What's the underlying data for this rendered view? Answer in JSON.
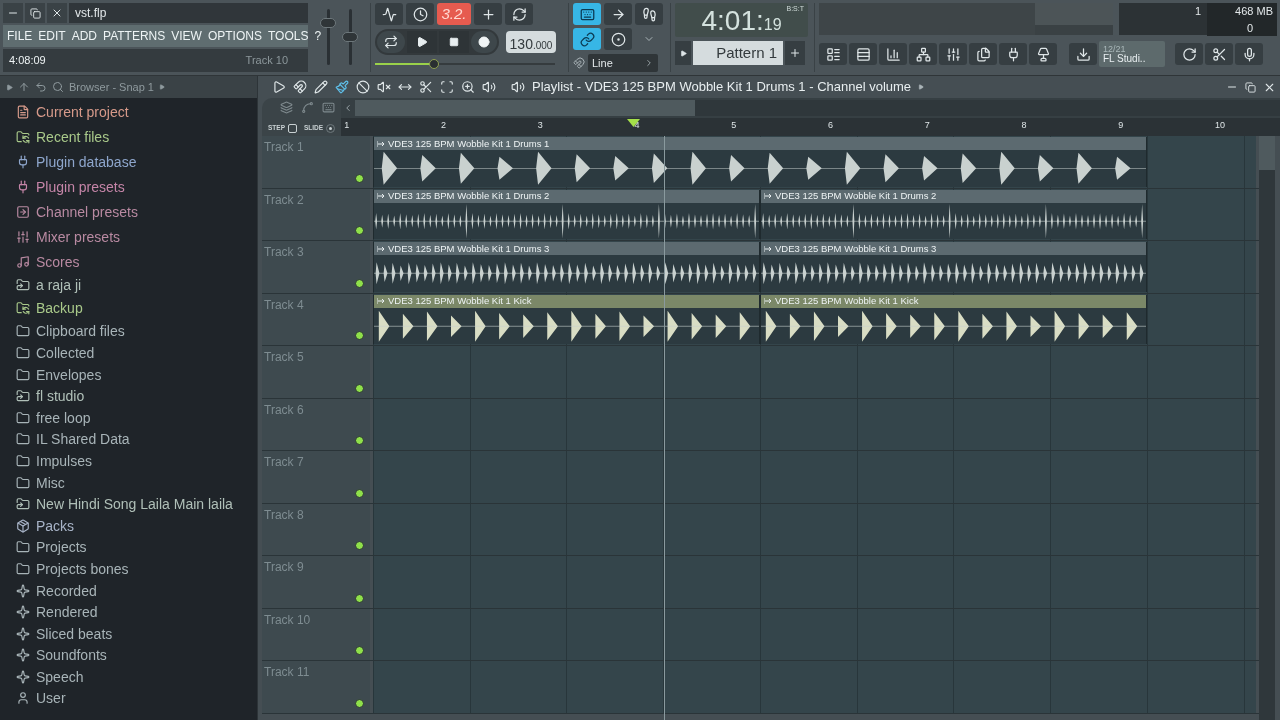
{
  "window": {
    "title": "vst.flp"
  },
  "menu": [
    "FILE",
    "EDIT",
    "ADD",
    "PATTERNS",
    "VIEW",
    "OPTIONS",
    "TOOLS",
    "?"
  ],
  "hint": {
    "time": "4:08:09",
    "target": "Track 10"
  },
  "master": {
    "volume": {
      "level": 0.8
    },
    "pitch": {
      "level": 0.5
    }
  },
  "transport": {
    "countdown": {
      "label": "3.2.",
      "on": true
    },
    "tempo": "130.000"
  },
  "song_position": {
    "level": 0.33
  },
  "mode_buttons": [
    {
      "kind": "typing-keyboard",
      "on": true
    },
    {
      "kind": "next",
      "on": false
    },
    {
      "kind": "step-edit",
      "on": false
    },
    {
      "kind": "multilink",
      "on": true
    }
  ],
  "snap": {
    "label": "Line"
  },
  "time_display": {
    "main": "4:01:",
    "small": "19",
    "unit": "B:S:T"
  },
  "pattern": {
    "name": "Pattern 1"
  },
  "monitor": {
    "cpu": "1",
    "memory": "468 MB",
    "polyphony": "0"
  },
  "news": {
    "counter": "12/21",
    "title": "FL Studi.."
  },
  "browser": {
    "title": "Browser - Snap 1",
    "items": [
      {
        "label": "Current project",
        "kind": "project",
        "color": "#d79a8a"
      },
      {
        "label": "Recent files",
        "kind": "recent",
        "color": "#a9c98a"
      },
      {
        "label": "Plugin database",
        "kind": "plugin",
        "color": "#8ea6cc"
      },
      {
        "label": "Plugin presets",
        "kind": "plugin",
        "color": "#c585a8"
      },
      {
        "label": "Channel presets",
        "kind": "channel",
        "color": "#b98aa2"
      },
      {
        "label": "Mixer presets",
        "kind": "mixer",
        "color": "#b98aa2"
      },
      {
        "label": "Scores",
        "kind": "score",
        "color": "#b98aa2"
      },
      {
        "label": "a raja ji",
        "kind": "link-folder",
        "color": "#b0c0b8"
      },
      {
        "label": "Backup",
        "kind": "recent",
        "color": "#a9c98a"
      },
      {
        "label": "Clipboard files",
        "kind": "folder",
        "color": "#a8b4b8"
      },
      {
        "label": "Collected",
        "kind": "folder",
        "color": "#a8b4b8"
      },
      {
        "label": "Envelopes",
        "kind": "folder",
        "color": "#a8b4b8"
      },
      {
        "label": "fl studio",
        "kind": "link-folder",
        "color": "#b0c0b8"
      },
      {
        "label": "free loop",
        "kind": "folder",
        "color": "#a8b4b8"
      },
      {
        "label": "IL Shared Data",
        "kind": "folder",
        "color": "#a8b4b8"
      },
      {
        "label": "Impulses",
        "kind": "folder",
        "color": "#a8b4b8"
      },
      {
        "label": "Misc",
        "kind": "folder",
        "color": "#a8b4b8"
      },
      {
        "label": "New Hindi Song Laila Main laila",
        "kind": "link-folder",
        "color": "#b0c0b8"
      },
      {
        "label": "Packs",
        "kind": "packs",
        "color": "#a8b4c8"
      },
      {
        "label": "Projects",
        "kind": "folder",
        "color": "#a8b4b8"
      },
      {
        "label": "Projects bones",
        "kind": "folder",
        "color": "#a8b4b8"
      },
      {
        "label": "Recorded",
        "kind": "special",
        "color": "#a8b4b8"
      },
      {
        "label": "Rendered",
        "kind": "special",
        "color": "#a8b4b8"
      },
      {
        "label": "Sliced beats",
        "kind": "special",
        "color": "#a8b4b8"
      },
      {
        "label": "Soundfonts",
        "kind": "special",
        "color": "#a8b4b8"
      },
      {
        "label": "Speech",
        "kind": "special",
        "color": "#a8b4b8"
      },
      {
        "label": "User",
        "kind": "user",
        "color": "#a8b4b8"
      }
    ]
  },
  "playlist": {
    "title": "Playlist - VDE3 125 BPM Wobble Kit 1 Drums 1 - Channel volume",
    "step": {
      "label": "STEP",
      "checked": false
    },
    "slide": {
      "label": "SLIDE",
      "checked": true
    },
    "ruler": [
      "1",
      "2",
      "3",
      "4",
      "5",
      "6",
      "7",
      "8",
      "9",
      "10"
    ],
    "tracks": [
      {
        "name": "Track 1",
        "active": true,
        "clips": [
          {
            "name": "VDE3 125 BPM Wobble Kit 1 Drums 1",
            "kind": "hits",
            "color": "#5c6a70"
          }
        ]
      },
      {
        "name": "Track 2",
        "active": true,
        "clips": [
          {
            "name": "VDE3 125 BPM Wobble Kit 1 Drums 2",
            "kind": "dense",
            "color": "#5c6a70"
          },
          {
            "name": "VDE3 125 BPM Wobble Kit 1 Drums 2",
            "kind": "dense",
            "color": "#5c6a70"
          }
        ]
      },
      {
        "name": "Track 3",
        "active": true,
        "clips": [
          {
            "name": "VDE3 125 BPM Wobble Kit 1 Drums 3",
            "kind": "soft",
            "color": "#5c6a70"
          },
          {
            "name": "VDE3 125 BPM Wobble Kit 1 Drums 3",
            "kind": "soft",
            "color": "#5c6a70"
          }
        ]
      },
      {
        "name": "Track 4",
        "active": true,
        "clips": [
          {
            "name": "VDE3 125 BPM Wobble Kit 1 Kick",
            "kind": "kick",
            "color": "#7b8868"
          },
          {
            "name": "VDE3 125 BPM Wobble Kit 1 Kick",
            "kind": "kick",
            "color": "#7b8868"
          }
        ]
      },
      {
        "name": "Track 5",
        "active": true
      },
      {
        "name": "Track 6",
        "active": true
      },
      {
        "name": "Track 7",
        "active": true
      },
      {
        "name": "Track 8",
        "active": true
      },
      {
        "name": "Track 9",
        "active": true
      },
      {
        "name": "Track 10",
        "active": true
      },
      {
        "name": "Track 11",
        "active": true
      }
    ]
  }
}
